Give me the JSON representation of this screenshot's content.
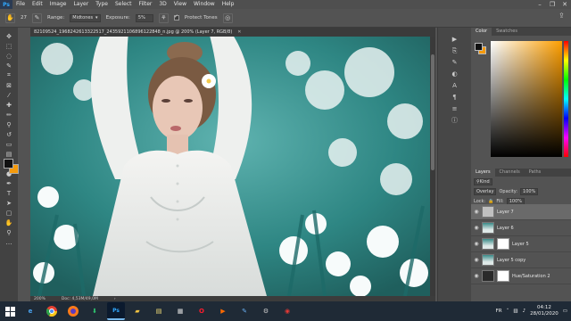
{
  "menu": {
    "logo": "Ps",
    "items": [
      "File",
      "Edit",
      "Image",
      "Layer",
      "Type",
      "Select",
      "Filter",
      "3D",
      "View",
      "Window",
      "Help"
    ],
    "window_controls": [
      "–",
      "❐",
      "✕"
    ]
  },
  "options": {
    "brush_size": "27",
    "range_label": "Range:",
    "range_value": "Midtones",
    "exposure_label": "Exposure:",
    "exposure_value": "5%",
    "protect_tones_label": "Protect Tones",
    "protect_tones_checked": true
  },
  "document": {
    "tab_title": "82109524_1968242613322517_2435921106896122848_n.jpg @ 200% (Layer 7, RGB/8)",
    "zoom": "200%",
    "doc_info": "Doc: 4,53M/49,0M"
  },
  "colors": {
    "foreground": "#111111",
    "background": "#f59a0c",
    "accent": "#31a8ff"
  },
  "color_panel": {
    "tabs": [
      "Color",
      "Swatches"
    ]
  },
  "layers_panel": {
    "tabs": [
      "Layers",
      "Channels",
      "Paths"
    ],
    "kind_label": "Kind",
    "blend_mode": "Overlay",
    "opacity_label": "Opacity:",
    "opacity_value": "100%",
    "lock_label": "Lock:",
    "fill_label": "Fill:",
    "fill_value": "100%",
    "layers": [
      {
        "name": "Layer 7",
        "thumb": "blank",
        "selected": true
      },
      {
        "name": "Layer 6",
        "thumb": "img",
        "selected": false
      },
      {
        "name": "Layer 5",
        "thumb": "img",
        "mask": true,
        "selected": false
      },
      {
        "name": "Layer 5 copy",
        "thumb": "img",
        "selected": false
      },
      {
        "name": "Hue/Saturation 2",
        "thumb": "adj",
        "mask": true,
        "selected": false
      }
    ]
  },
  "taskbar": {
    "language": "FR",
    "time": "04:12",
    "date": "28/01/2020"
  }
}
